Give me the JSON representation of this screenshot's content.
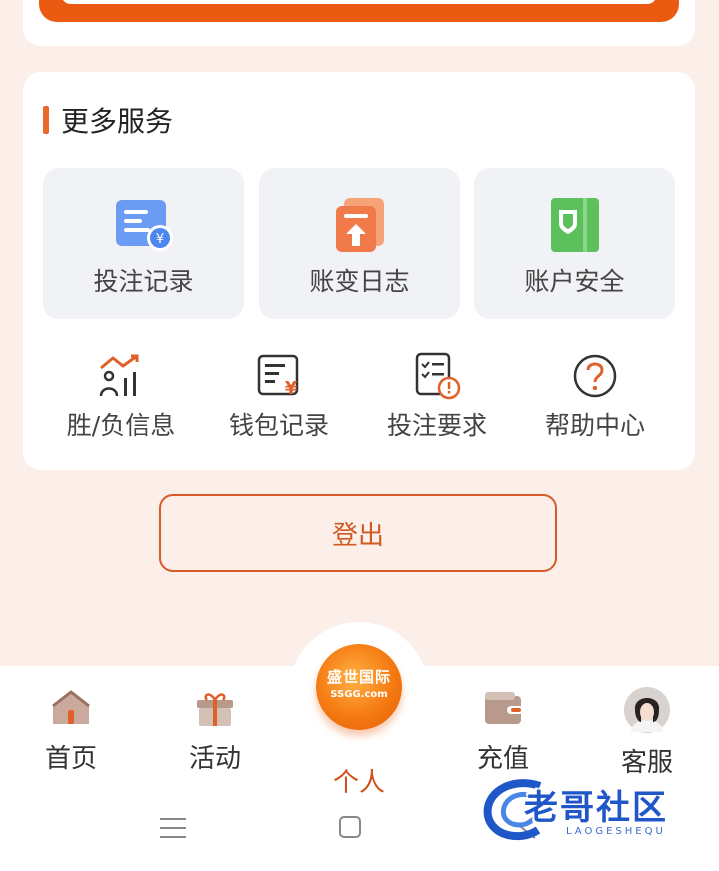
{
  "more_services": {
    "title": "更多服务",
    "tiles": [
      {
        "label": "投注记录",
        "icon": "bet-record-icon"
      },
      {
        "label": "账变日志",
        "icon": "account-change-log-icon"
      },
      {
        "label": "账户安全",
        "icon": "account-security-icon"
      }
    ],
    "items": [
      {
        "label": "胜/负信息",
        "icon": "win-loss-chart-icon"
      },
      {
        "label": "钱包记录",
        "icon": "wallet-record-icon"
      },
      {
        "label": "投注要求",
        "icon": "bet-requirement-icon"
      },
      {
        "label": "帮助中心",
        "icon": "help-question-icon"
      }
    ]
  },
  "logout": {
    "label": "登出"
  },
  "tabbar": {
    "tabs": [
      {
        "label": "首页",
        "icon": "home-icon"
      },
      {
        "label": "活动",
        "icon": "gift-icon"
      },
      {
        "label": "个人",
        "icon": "brand-logo",
        "active": true
      },
      {
        "label": "充值",
        "icon": "wallet-icon"
      },
      {
        "label": "客服",
        "icon": "support-avatar"
      }
    ],
    "logo_text": "盛世国际",
    "logo_subtext": "SSGG.com"
  },
  "watermark": {
    "main": "老哥社区",
    "sub": "LAOGESHEQU"
  },
  "colors": {
    "accent": "#ea5a10",
    "background": "#fcefe9",
    "active_tab": "#d0521c"
  }
}
